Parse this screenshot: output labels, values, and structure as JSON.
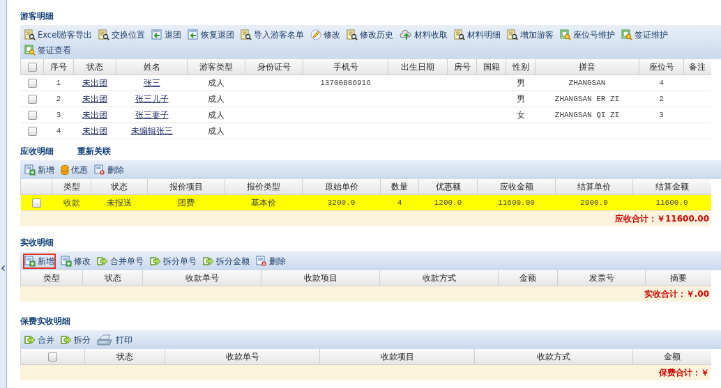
{
  "sections": [
    {
      "kind": "guests",
      "title": "游客明细",
      "toolbar": [
        {
          "label": "Excel游客导出",
          "kind": "doc-search"
        },
        {
          "label": "交换位置",
          "kind": "doc-search"
        },
        {
          "label": "退团",
          "kind": "doc-return"
        },
        {
          "label": "恢复退团",
          "kind": "doc-return"
        },
        {
          "label": "导入游客名单",
          "kind": "doc-search"
        },
        {
          "label": "修改",
          "kind": "pencil"
        },
        {
          "label": "修改历史",
          "kind": "doc-search"
        },
        {
          "label": "材料收取",
          "kind": "upload"
        },
        {
          "label": "材料明细",
          "kind": "doc-search"
        },
        {
          "label": "增加游客",
          "kind": "doc-search"
        },
        {
          "label": "座位号维护",
          "kind": "doc-search-green"
        },
        {
          "label": "签证维护",
          "kind": "doc-search-green"
        },
        {
          "label": "签证查看",
          "kind": "doc-search-green"
        }
      ],
      "table": {
        "header_checkbox": {
          "checked": false
        },
        "columns": [
          "序号",
          "状态",
          "姓名",
          "游客类型",
          "身份证号",
          "手机号",
          "出生日期",
          "房号",
          "国籍",
          "性别",
          "拼音",
          "座位号",
          "备注"
        ],
        "rows": [
          {
            "checked": false,
            "no": "1",
            "status": "未出团",
            "name": "张三",
            "type": "成人",
            "mobile": "13700886916",
            "gender": "男",
            "pinyin": "ZHANGSAN",
            "seat": "4"
          },
          {
            "checked": false,
            "no": "2",
            "status": "未出团",
            "name": "张三儿子",
            "type": "成人",
            "gender": "男",
            "pinyin": "ZHANGSAN ER ZI",
            "seat": "2"
          },
          {
            "checked": false,
            "no": "3",
            "status": "未出团",
            "name": "张三妻子",
            "type": "成人",
            "gender": "女",
            "pinyin": "ZHANGSAN QI ZI",
            "seat": "3"
          },
          {
            "checked": false,
            "no": "4",
            "status": "未出团",
            "name": "未编辑张三",
            "type": "成人"
          }
        ]
      }
    },
    {
      "kind": "receivable",
      "title": "应收明细",
      "link": "重新关联",
      "toolbar": [
        {
          "label": "新增",
          "kind": "doc-add"
        },
        {
          "label": "优惠",
          "kind": "coins"
        },
        {
          "label": "删除",
          "kind": "doc-delete"
        }
      ],
      "table": {
        "columns": [
          "类型",
          "状态",
          "报价项目",
          "报价类型",
          "原始单价",
          "数量",
          "优惠额",
          "应收金额",
          "结算单价",
          "结算金额"
        ],
        "rows": [
          {
            "checked": false,
            "selected": true,
            "type": "收款",
            "status": "未报送",
            "item": "团费",
            "price_type": "基本价",
            "orig_price": "3200.0",
            "qty": "4",
            "discount": "1200.0",
            "receivable": "11600.00",
            "settle_price": "2900.0",
            "settle_amount": "11600.0"
          }
        ]
      },
      "total": "应收合计：￥11600.00"
    },
    {
      "kind": "received",
      "title": "实收明细",
      "toolbar": [
        {
          "label": "新增",
          "kind": "doc-add",
          "highlighted": true
        },
        {
          "label": "修改",
          "kind": "doc-add",
          "highlighted": false
        },
        {
          "label": "合并单号",
          "kind": "arrow-out",
          "highlighted": false
        },
        {
          "label": "拆分单号",
          "kind": "arrow-out",
          "highlighted": false
        },
        {
          "label": "拆分金额",
          "kind": "arrow-out",
          "highlighted": false
        },
        {
          "label": "删除",
          "kind": "doc-delete",
          "highlighted": false
        }
      ],
      "table": {
        "columns": [
          "类型",
          "状态",
          "收款单号",
          "收款项目",
          "收款方式",
          "金额",
          "发票号",
          "摘要"
        ]
      },
      "total": "实收合计：￥.00"
    },
    {
      "kind": "insurance",
      "title": "保费实收明细",
      "toolbar": [
        {
          "label": "合并",
          "kind": "arrow-out"
        },
        {
          "label": "拆分",
          "kind": "arrow-out"
        },
        {
          "label": "打印",
          "kind": "printer"
        }
      ],
      "table": {
        "header_checkbox": {
          "checked": false
        },
        "columns": [
          "状态",
          "收款单号",
          "收款项目",
          "收款方式",
          "金额"
        ]
      },
      "total": "保费合计：￥"
    }
  ]
}
